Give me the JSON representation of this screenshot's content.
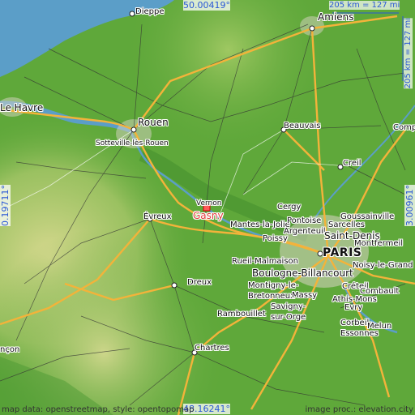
{
  "map": {
    "target_city": "Gasny",
    "coordinates": {
      "north": "50.00419°",
      "south": "48.16241°",
      "west": "0.19711°",
      "east": "3.00961°"
    },
    "scale": {
      "horizontal": "205 km = 127 mi",
      "vertical": "205 km = 127 mi"
    },
    "credits": {
      "left": "map data: openstreetmap, style: opentopomap",
      "right": "image proc.: elevation.city"
    },
    "places": {
      "dieppe": "Dieppe",
      "amiens": "Amiens",
      "le_havre": "Le Havre",
      "rouen": "Rouen",
      "sotteville": "Sotteville-lès-Rouen",
      "beauvais": "Beauvais",
      "compiegne": "Compi",
      "creil": "Creil",
      "vernon": "Vernon",
      "gasny": "Gasny",
      "evreux": "Évreux",
      "cergy": "Cergy",
      "mantes": "Mantes-la-Jolie",
      "pontoise": "Pontoise",
      "goussainville": "Goussainville",
      "poissy": "Poissy",
      "argenteuil": "Argenteuil",
      "sarcelles": "Sarcelles",
      "saint_denis": "Saint-Denis",
      "montfermeil": "Montfermeil",
      "paris": "PARIS",
      "rueil": "Rueil-Malmaison",
      "noisy": "Noisy-le-Grand",
      "boulogne": "Boulogne-Billancourt",
      "dreux": "Dreux",
      "montigny": "Montigny-le-Bretonneux",
      "creteil": "Créteil",
      "combault": "Combault",
      "massy": "Massy",
      "athis": "Athis-Mons",
      "savigny": "Savigny-sur-Orge",
      "evry": "Evry",
      "rambouillet": "Rambouillet",
      "corbeil": "Corbeil-Essonnes",
      "melun": "Melun",
      "chartres": "Chartres",
      "alencon": "nçon"
    }
  },
  "colors": {
    "sea": "#5b9ec8",
    "lowland": "#5fa83a",
    "highland": "#c9d48a",
    "roads_major": "#f3b33a",
    "roads_minor": "#333333",
    "target": "#e23b3b",
    "coords": "#2a58d6"
  }
}
